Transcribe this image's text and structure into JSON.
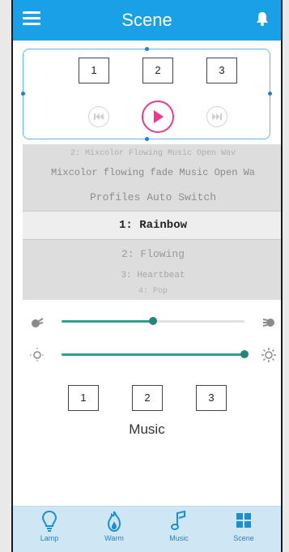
{
  "header": {
    "title": "Scene",
    "menu_icon": "menu-icon",
    "bell_icon": "bell-icon"
  },
  "scene_controls": {
    "slots": [
      "1",
      "2",
      "3"
    ],
    "prev_icon": "skip-back-icon",
    "play_icon": "play-icon",
    "next_icon": "skip-forward-icon",
    "accent": "#ea3a8d"
  },
  "picker": {
    "rows": [
      "2: Mixcolor Flowing Music Open Wav",
      "Mixcolor flowing fade Music Open Wa",
      "Profiles Auto Switch",
      "1: Rainbow",
      "2: Flowing",
      "3: Heartbeat",
      "4: Pop"
    ],
    "selected_index": 3
  },
  "sliders": [
    {
      "name": "speed",
      "value": 0.5,
      "left_icon": "slow-icon",
      "right_icon": "fast-icon"
    },
    {
      "name": "brightness",
      "value": 1.0,
      "left_icon": "dim-sun-icon",
      "right_icon": "bright-sun-icon"
    }
  ],
  "music": {
    "slots": [
      "1",
      "2",
      "3"
    ],
    "label": "Music"
  },
  "tabs": [
    {
      "label": "Lamp",
      "icon": "bulb-icon"
    },
    {
      "label": "Warm",
      "icon": "flame-icon"
    },
    {
      "label": "Music",
      "icon": "music-note-icon"
    },
    {
      "label": "Scene",
      "icon": "scene-grid-icon"
    }
  ],
  "colors": {
    "primary": "#1aa0e6",
    "slider": "#2f9f90",
    "tabbar": "#cfe7f4"
  }
}
